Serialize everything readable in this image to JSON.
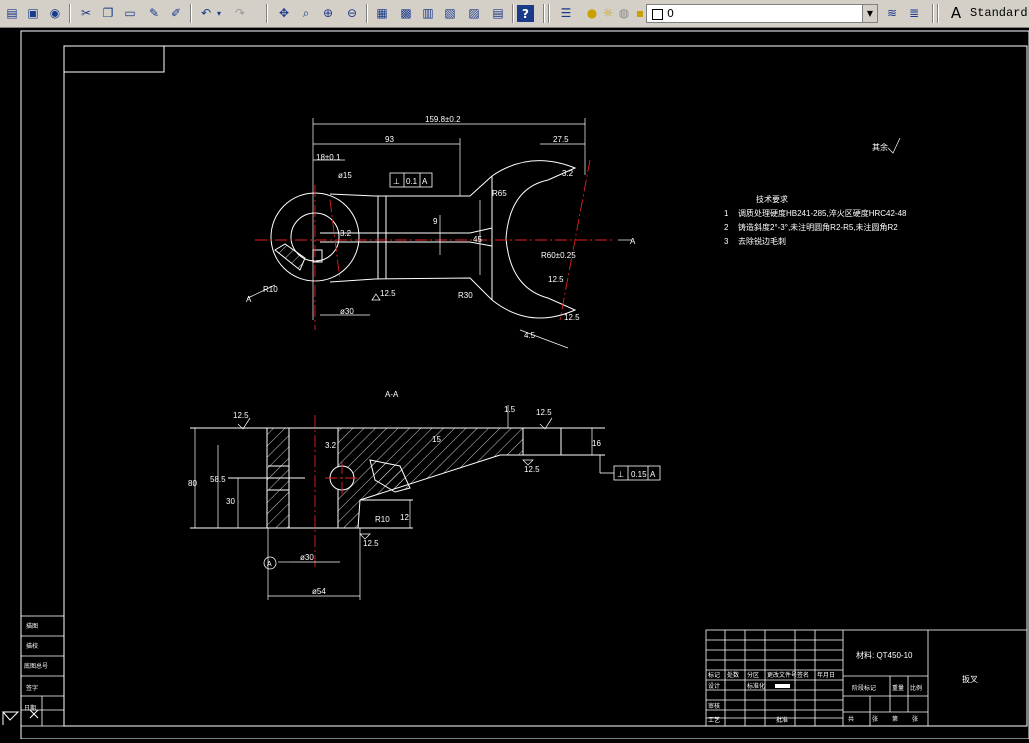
{
  "toolbar": {
    "current_layer": "0",
    "text_style": "Standard"
  },
  "drawing": {
    "top_view": {
      "dim_overall": "159.8±0.2",
      "dim_93": "93",
      "dim_27_5": "27.5",
      "dim_18": "18±0.1",
      "dim_phi15": "ø15",
      "tol_perp": "0.1",
      "datum": "A",
      "dim_9": "9",
      "dim_45": "45",
      "dim_r65": "R65",
      "dim_r60": "R60±0.25",
      "dim_r30": "R30",
      "dim_phi30": "ø30",
      "rough_12_5": "12.5",
      "dim_4_5": "4.5",
      "dim_r10": "R10",
      "dim_3_2": "3.2",
      "section_label": "A",
      "rough_12_5_b": "12.5",
      "rough_12_5_c": "12.5",
      "rough_3_2_b": "3.2"
    },
    "section_view": {
      "title": "A-A",
      "rough_top": "12.5",
      "rough_right": "12.5",
      "rough_left_bottom": "12.5",
      "rough_right_bottom": "12.5",
      "dim_1_5": "1.5",
      "dim_80": "80",
      "dim_58_5": "58.5",
      "dim_30": "30",
      "dim_phi30": "ø30",
      "dim_phi54": "ø54",
      "dim_15": "15",
      "dim_12": "12",
      "dim_r10": "R10",
      "dim_3_2": "3.2",
      "dim_16": "16",
      "tol_perp": "0.15",
      "datum": "A",
      "datum_bubble": "A"
    },
    "notes": {
      "rough_general": "其余",
      "heading": "技术要求",
      "line1_num": "1",
      "line1_text": "调质处理硬度HB241-285,淬火区硬度HRC42-48",
      "line2_num": "2",
      "line2_text": "铸造斜度2°-3°,未注明圆角R2-R5,未注圆角R2",
      "line3_num": "3",
      "line3_text": "去除锐边毛刺"
    },
    "title_block": {
      "material": "材料: QT450-10",
      "part_name": "扳叉",
      "designer": "设计",
      "checker": "审核",
      "process": "工艺",
      "approve": "批准",
      "stage_mark": "阶段标记",
      "weight": "重量",
      "scale": "比例",
      "sheet": "共",
      "of": "张",
      "sheet_no": "第",
      "of2": "张",
      "std": "标准化",
      "date": "年月日",
      "mark": "标记",
      "count": "处数",
      "zone": "分区",
      "doc_no": "更改文件号",
      "sign": "签名"
    },
    "side_block": {
      "r1": "描图",
      "r2": "描校",
      "r3": "底图总号",
      "r4": "签字",
      "r5": "日期"
    }
  }
}
